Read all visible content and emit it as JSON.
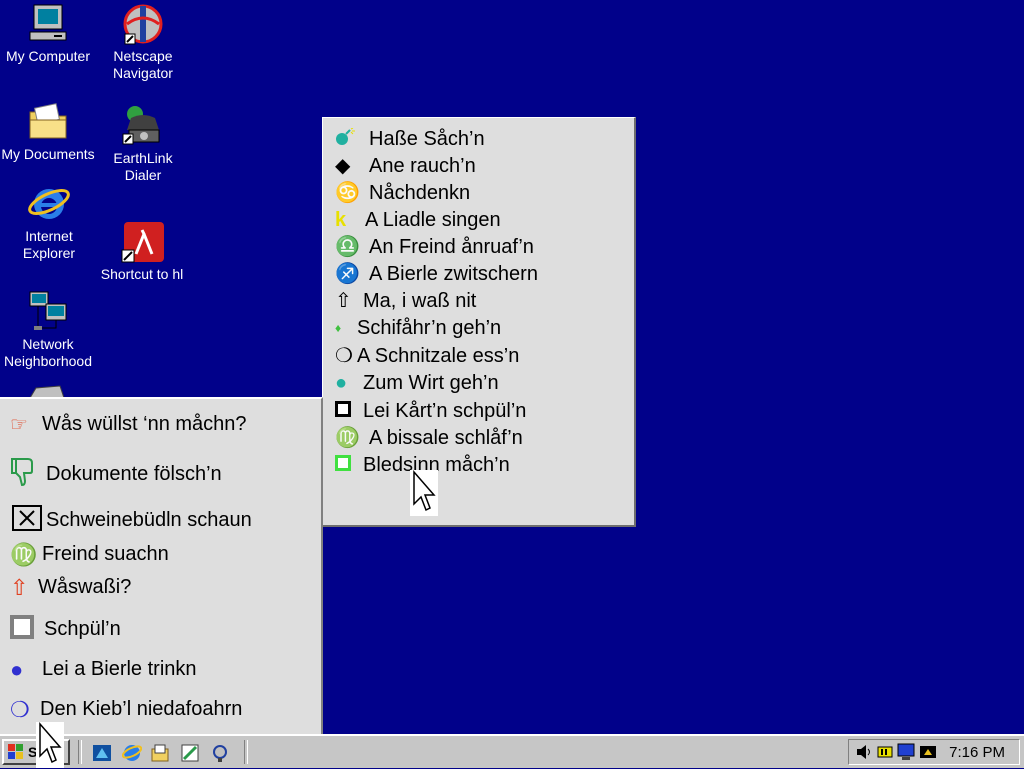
{
  "desktop": {
    "icons": [
      {
        "label": "My Computer",
        "icon": "computer-icon"
      },
      {
        "label": "Netscape Navigator",
        "icon": "netscape-icon"
      },
      {
        "label": "My Documents",
        "icon": "folder-icon"
      },
      {
        "label": "EarthLink Dialer",
        "icon": "phone-icon"
      },
      {
        "label": "Internet Explorer",
        "icon": "ie-icon"
      },
      {
        "label": "Shortcut to hl",
        "icon": "halflife-icon"
      },
      {
        "label": "Network Neighborhood",
        "icon": "network-icon"
      }
    ]
  },
  "start_menu": {
    "items": [
      {
        "label": "Wås wüllst ‘nn måchn?",
        "icon": "pointing-hand-icon",
        "glyph": "☞",
        "color": "#e04020"
      },
      {
        "label": "Dokumente fölsch’n",
        "icon": "thumbs-down-icon",
        "glyph": "👎",
        "color": "#2a9a4a"
      },
      {
        "label": "Schweinebüdln schaun",
        "icon": "boxed-x-icon",
        "glyph": "⊠",
        "color": "#000000"
      },
      {
        "label": "Freind suachn",
        "icon": "virgo-icon",
        "glyph": "♍",
        "color": "#e8e000"
      },
      {
        "label": "Wåswaßi?",
        "icon": "up-arrow-icon",
        "glyph": "⇧",
        "color": "#e04020"
      },
      {
        "label": "Schpül’n",
        "icon": "square-icon",
        "glyph": "▣",
        "color": "#808080"
      },
      {
        "label": "Lei a Bierle trinkn",
        "icon": "circle-icon",
        "glyph": "●",
        "color": "#3030d0"
      },
      {
        "label": "Den Kieb’l niedafoahrn",
        "icon": "crescent-icon",
        "glyph": "❍",
        "color": "#3030d0"
      }
    ]
  },
  "submenu": {
    "items": [
      {
        "label": "Haße Såch’n",
        "icon": "bomb-icon",
        "glyph": "💣",
        "color": "#20b0a0"
      },
      {
        "label": "Ane rauch’n",
        "icon": "diamond-icon",
        "glyph": "◆",
        "color": "#000000"
      },
      {
        "label": "Nåchdenkn",
        "icon": "cancer-icon",
        "glyph": "♋",
        "color": "#000000"
      },
      {
        "label": "A Liadle singen",
        "icon": "k-icon",
        "glyph": "k",
        "color": "#e8e000"
      },
      {
        "label": "An Freind ånruaf’n",
        "icon": "libra-icon",
        "glyph": "♎",
        "color": "#40c040"
      },
      {
        "label": "A Bierle zwitschern",
        "icon": "sagittarius-icon",
        "glyph": "♐",
        "color": "#3030d0"
      },
      {
        "label": "Ma, i waß nit",
        "icon": "up-arrow-icon",
        "glyph": "⇧",
        "color": "#000000"
      },
      {
        "label": "Schifåhr’n geh’n",
        "icon": "small-diamond-icon",
        "glyph": "♦",
        "color": "#40c040"
      },
      {
        "label": "A Schnitzale ess’n",
        "icon": "crescent-icon",
        "glyph": "❍",
        "color": "#000000"
      },
      {
        "label": "Zum Wirt geh’n",
        "icon": "circle-icon",
        "glyph": "●",
        "color": "#20b0a0"
      },
      {
        "label": "Lei Kårt’n schpül’n",
        "icon": "square-icon",
        "glyph": "◘",
        "color": "#000000"
      },
      {
        "label": "A bissale schlåf’n",
        "icon": "virgo-icon",
        "glyph": "♍",
        "color": "#e04020"
      },
      {
        "label": "Bledsinn måch’n",
        "icon": "square-icon",
        "glyph": "◘",
        "color": "#40e040"
      }
    ]
  },
  "taskbar": {
    "start_label": "Start",
    "clock": "7:16 PM"
  }
}
